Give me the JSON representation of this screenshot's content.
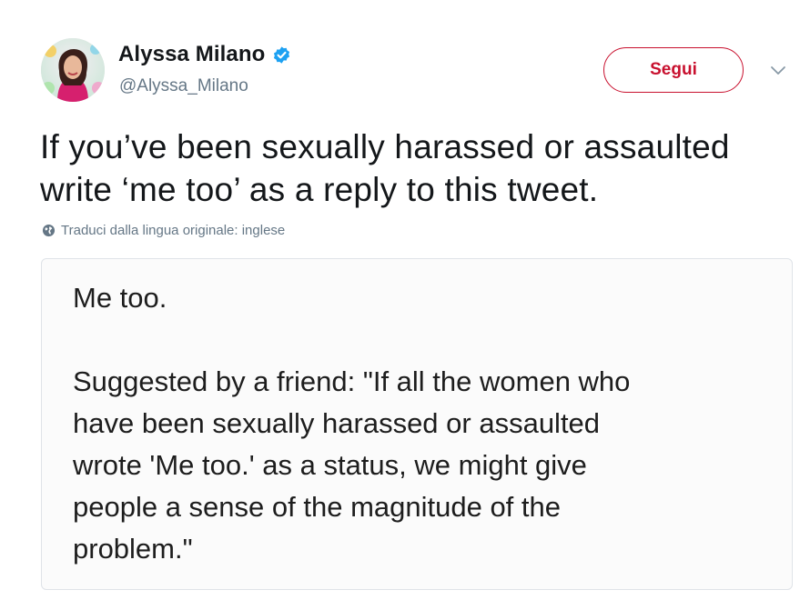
{
  "user": {
    "display_name": "Alyssa Milano",
    "handle": "@Alyssa_Milano",
    "verified": true,
    "avatar": "profile-photo-avatar"
  },
  "actions": {
    "follow_label": "Segui",
    "menu_icon": "chevron-down-icon"
  },
  "tweet": {
    "text_lines": [
      "If you’ve been sexually harassed or assaulted",
      "write ‘me too’ as a reply to this tweet."
    ],
    "translate_label": "Traduci dalla lingua originale: inglese",
    "translate_icon": "globe-icon"
  },
  "attachment": {
    "first_line": "Me too.",
    "body_lines": [
      "Suggested by a friend: \"If all the women who",
      "have been sexually harassed or assaulted",
      "wrote 'Me too.' as a status, we might give",
      "people a sense of the magnitude of the",
      "problem.\""
    ]
  },
  "colors": {
    "follow_accent": "#c8102e",
    "verified_blue": "#1da1f2",
    "secondary_text": "#657786",
    "primary_text": "#14171a"
  }
}
